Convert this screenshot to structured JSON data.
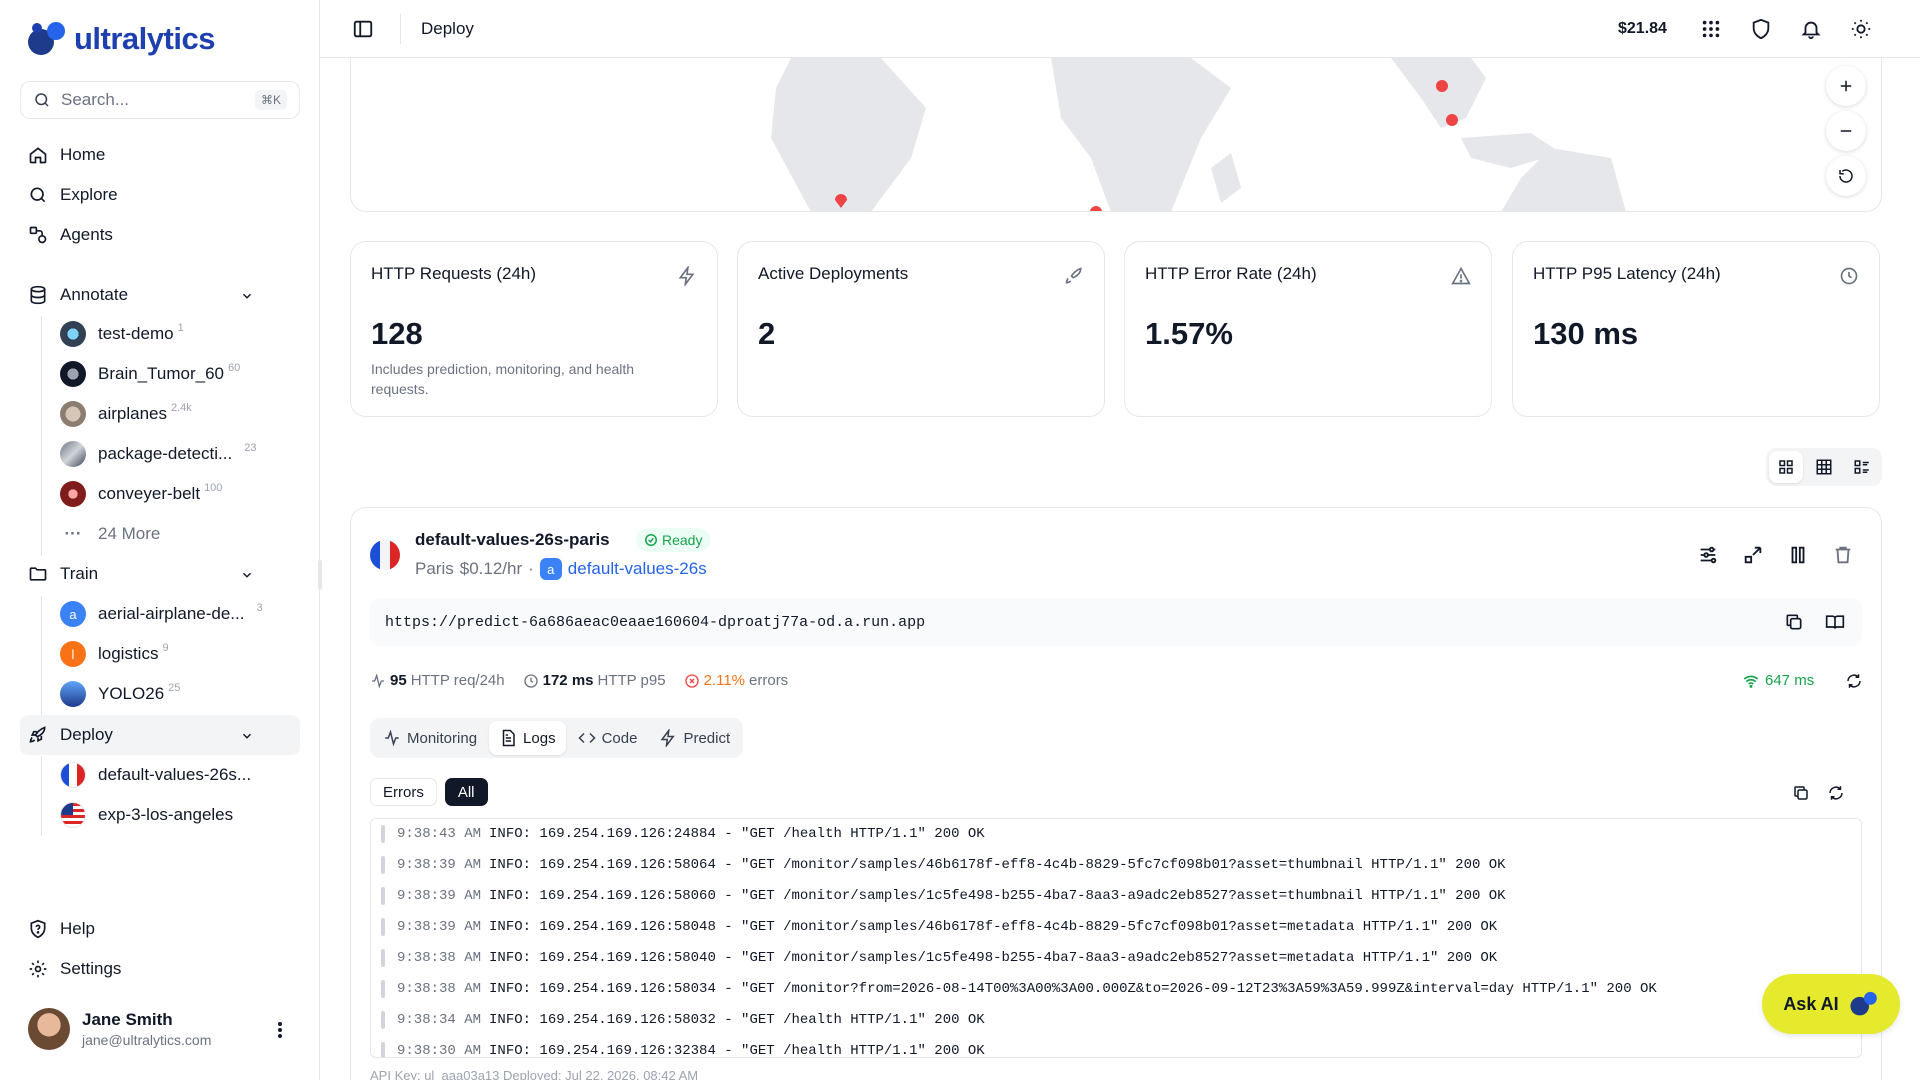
{
  "brand": {
    "name": "ultralytics"
  },
  "search": {
    "placeholder": "Search...",
    "shortcut": "⌘K"
  },
  "nav": {
    "home": "Home",
    "explore": "Explore",
    "agents": "Agents",
    "annotate": "Annotate",
    "train": "Train",
    "deploy": "Deploy",
    "help": "Help",
    "settings": "Settings"
  },
  "annotate_items": [
    {
      "label": "test-demo",
      "count": "1"
    },
    {
      "label": "Brain_Tumor_60",
      "count": "60"
    },
    {
      "label": "airplanes",
      "count": "2.4k"
    },
    {
      "label": "package-detecti...",
      "count": "23"
    },
    {
      "label": "conveyer-belt",
      "count": "100"
    }
  ],
  "annotate_more": "24 More",
  "train_items": [
    {
      "label": "aerial-airplane-de...",
      "count": "3",
      "initial": "a"
    },
    {
      "label": "logistics",
      "count": "9",
      "initial": "l"
    },
    {
      "label": "YOLO26",
      "count": "25"
    }
  ],
  "deploy_items": [
    {
      "label": "default-values-26s..."
    },
    {
      "label": "exp-3-los-angeles"
    }
  ],
  "user": {
    "name": "Jane Smith",
    "email": "jane@ultralytics.com"
  },
  "topbar": {
    "title": "Deploy",
    "credit": "$21.84"
  },
  "stats": [
    {
      "title": "HTTP Requests (24h)",
      "value": "128",
      "desc": "Includes prediction, monitoring, and health requests.",
      "icon": "bolt-icon"
    },
    {
      "title": "Active Deployments",
      "value": "2",
      "desc": "",
      "icon": "rocket-icon"
    },
    {
      "title": "HTTP Error Rate (24h)",
      "value": "1.57%",
      "desc": "",
      "icon": "warning-icon"
    },
    {
      "title": "HTTP P95 Latency (24h)",
      "value": "130 ms",
      "desc": "",
      "icon": "clock-icon"
    }
  ],
  "deployment": {
    "name": "default-values-26s-paris",
    "status": "Ready",
    "region": "Paris",
    "price": "$0.12/hr",
    "separator": "·",
    "project_initial": "a",
    "project": "default-values-26s",
    "url": "https://predict-6a686aeac0eaae160604-dproatj77a-od.a.run.app",
    "metrics": {
      "req": "95",
      "req_label": "HTTP req/24h",
      "p95": "172 ms",
      "p95_label": "HTTP p95",
      "errors": "2.11%",
      "errors_label": "errors"
    },
    "ping": "647 ms",
    "tabs": [
      "Monitoring",
      "Logs",
      "Code",
      "Predict"
    ],
    "active_tab": "Logs",
    "filters": [
      "Errors",
      "All"
    ],
    "active_filter": "All",
    "logs": [
      {
        "ts": "9:38:43 AM",
        "msg": "INFO: 169.254.169.126:24884 - \"GET /health HTTP/1.1\" 200 OK"
      },
      {
        "ts": "9:38:39 AM",
        "msg": "INFO: 169.254.169.126:58064 - \"GET /monitor/samples/46b6178f-eff8-4c4b-8829-5fc7cf098b01?asset=thumbnail HTTP/1.1\" 200 OK"
      },
      {
        "ts": "9:38:39 AM",
        "msg": "INFO: 169.254.169.126:58060 - \"GET /monitor/samples/1c5fe498-b255-4ba7-8aa3-a9adc2eb8527?asset=thumbnail HTTP/1.1\" 200 OK"
      },
      {
        "ts": "9:38:39 AM",
        "msg": "INFO: 169.254.169.126:58048 - \"GET /monitor/samples/46b6178f-eff8-4c4b-8829-5fc7cf098b01?asset=metadata HTTP/1.1\" 200 OK"
      },
      {
        "ts": "9:38:38 AM",
        "msg": "INFO: 169.254.169.126:58040 - \"GET /monitor/samples/1c5fe498-b255-4ba7-8aa3-a9adc2eb8527?asset=metadata HTTP/1.1\" 200 OK"
      },
      {
        "ts": "9:38:38 AM",
        "msg": "INFO: 169.254.169.126:58034 - \"GET /monitor?from=2026-08-14T00%3A00%3A00.000Z&to=2026-09-12T23%3A59%3A59.999Z&interval=day HTTP/1.1\" 200 OK"
      },
      {
        "ts": "9:38:34 AM",
        "msg": "INFO: 169.254.169.126:58032 - \"GET /health HTTP/1.1\" 200 OK"
      },
      {
        "ts": "9:38:30 AM",
        "msg": "INFO: 169.254.169.126:32384 - \"GET /health HTTP/1.1\" 200 OK"
      }
    ],
    "footer": "API Key: ul_aaa03a13          Deployed: Jul 22, 2026, 08:42 AM"
  },
  "ask_ai": "Ask AI",
  "colors": {
    "brand": "#1e40af",
    "ready": "#16a34a",
    "error": "#f97316",
    "ask_ai_bg": "#e6ea2c"
  }
}
